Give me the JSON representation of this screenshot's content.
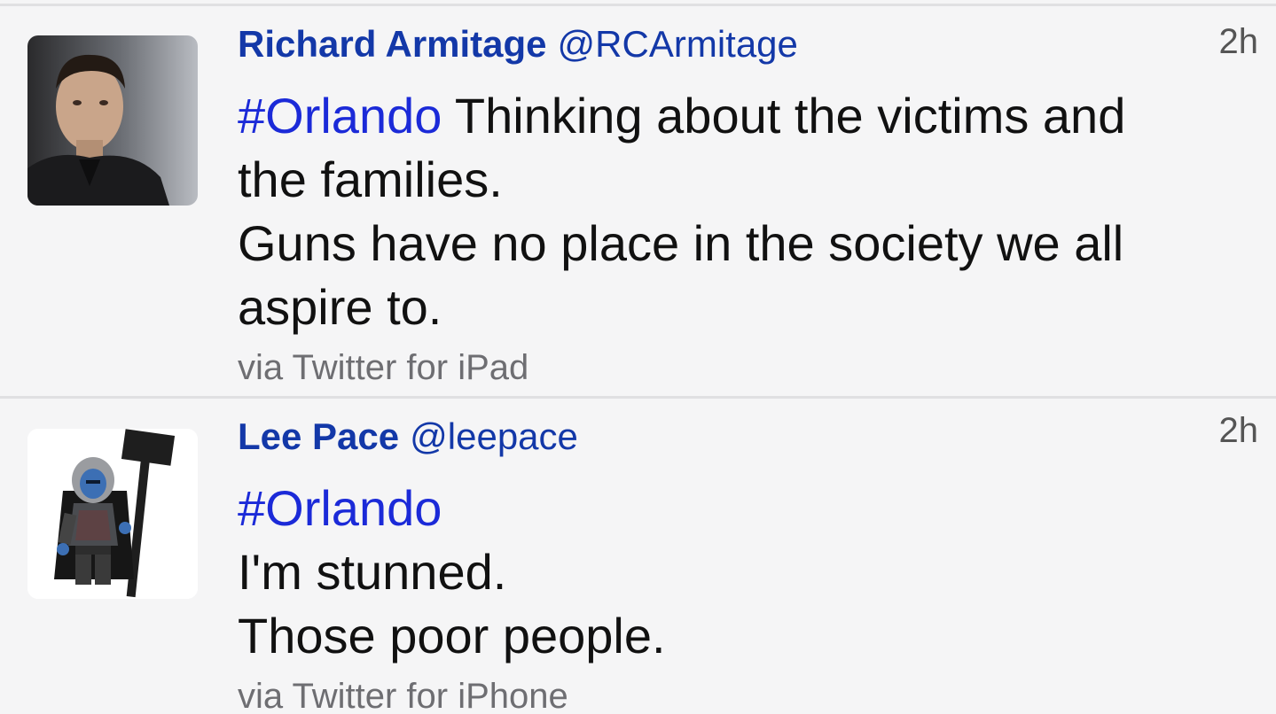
{
  "tweets": [
    {
      "display_name": "Richard Armitage",
      "handle": "@RCArmitage",
      "time": "2h",
      "hashtag": "#Orlando",
      "lines": [
        " Thinking about the victims and",
        "the families.",
        "Guns have no place in the society we all",
        "aspire to."
      ],
      "source": "via Twitter for iPad"
    },
    {
      "display_name": "Lee Pace",
      "handle": "@leepace",
      "time": "2h",
      "hashtag": "#Orlando",
      "lines": [
        "",
        "I'm stunned.",
        "Those poor people."
      ],
      "source": "via Twitter for iPhone"
    }
  ],
  "colors": {
    "background": "#f5f5f6",
    "name": "#1338a8",
    "hashtag": "#1b2ad8",
    "text": "#111111",
    "meta": "#6e6e72"
  }
}
